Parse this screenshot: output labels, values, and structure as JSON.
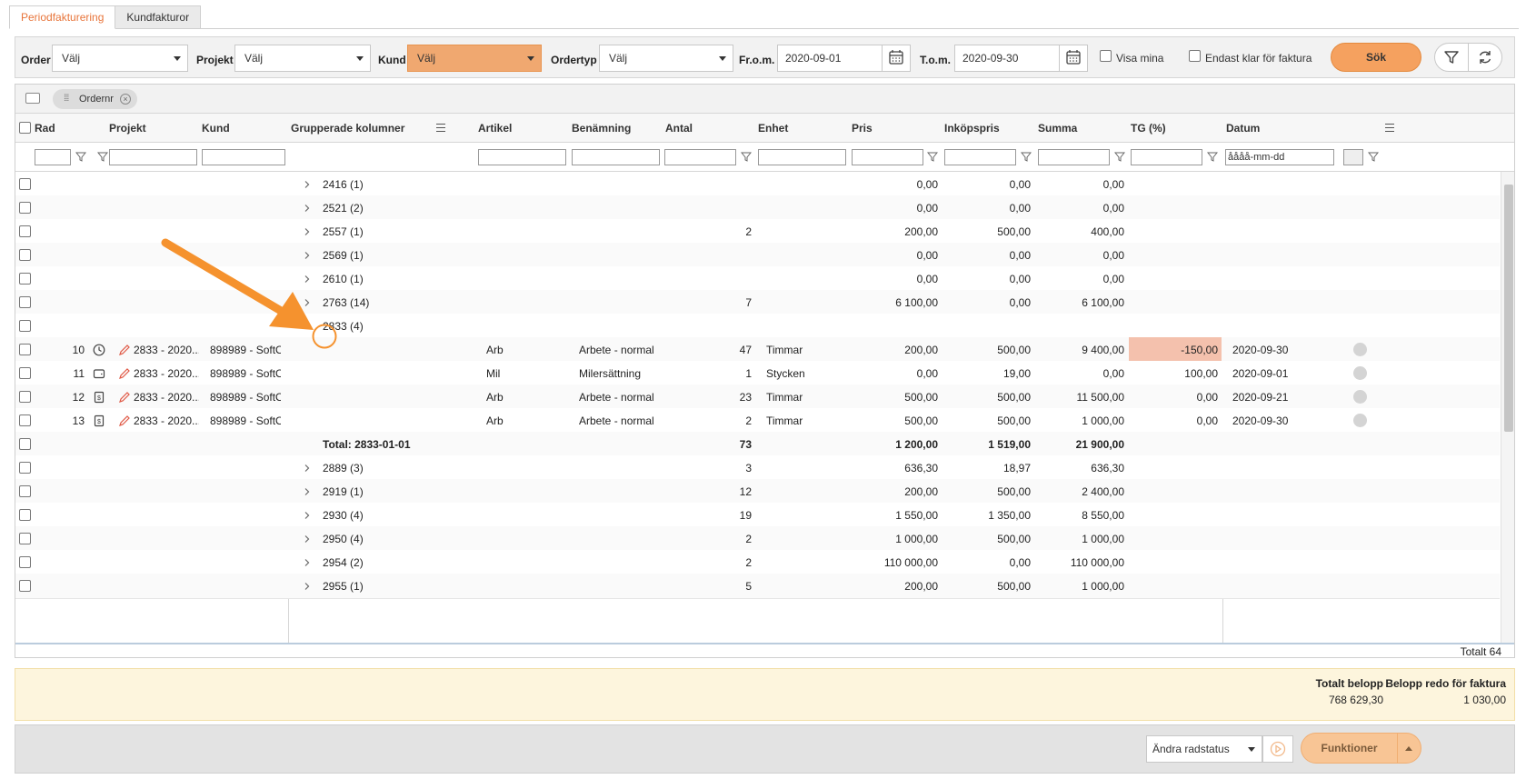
{
  "tabs": [
    {
      "label": "Periodfakturering"
    },
    {
      "label": "Kundfakturor"
    }
  ],
  "toolbar": {
    "order_label": "Order",
    "order_value": "Välj",
    "projekt_label": "Projekt",
    "projekt_value": "Välj",
    "kund_label": "Kund",
    "kund_value": "Välj",
    "ordertyp_label": "Ordertyp",
    "ordertyp_value": "Välj",
    "from_label": "Fr.o.m.",
    "from_value": "2020-09-01",
    "tom_label": "T.o.m.",
    "tom_value": "2020-09-30",
    "visa_mina": "Visa mina",
    "endast_klar": "Endast klar för faktura",
    "search_button": "Sök"
  },
  "group_chip": "Ordernr",
  "columns": {
    "rad": "Rad",
    "projekt": "Projekt",
    "kund": "Kund",
    "grupperade": "Grupperade kolumner",
    "artikel": "Artikel",
    "benamning": "Benämning",
    "antal": "Antal",
    "enhet": "Enhet",
    "pris": "Pris",
    "inkopspris": "Inköpspris",
    "summa": "Summa",
    "tg": "TG (%)",
    "datum": "Datum"
  },
  "date_filter_placeholder": "åååå-mm-dd",
  "group_rows_top": [
    {
      "label": "2416 (1)",
      "antal": "",
      "pris": "0,00",
      "inkop": "0,00",
      "summa": "0,00"
    },
    {
      "label": "2521 (2)",
      "antal": "",
      "pris": "0,00",
      "inkop": "0,00",
      "summa": "0,00"
    },
    {
      "label": "2557 (1)",
      "antal": "2",
      "pris": "200,00",
      "inkop": "500,00",
      "summa": "400,00"
    },
    {
      "label": "2569 (1)",
      "antal": "",
      "pris": "0,00",
      "inkop": "0,00",
      "summa": "0,00"
    },
    {
      "label": "2610 (1)",
      "antal": "",
      "pris": "0,00",
      "inkop": "0,00",
      "summa": "0,00"
    },
    {
      "label": "2763 (14)",
      "antal": "7",
      "pris": "6 100,00",
      "inkop": "0,00",
      "summa": "6 100,00"
    }
  ],
  "expanded_group": {
    "label": "2833 (4)"
  },
  "detail_rows": [
    {
      "rad": "10",
      "icon": "clock-icon",
      "projekt": "2833 - 2020...",
      "kund": "898989 - SoftO...",
      "artikel": "Arb",
      "benamning": "Arbete - normal ...",
      "antal": "47",
      "enhet": "Timmar",
      "pris": "200,00",
      "inkop": "500,00",
      "summa": "9 400,00",
      "tg": "-150,00",
      "datum": "2020-09-30",
      "tg_negative": true
    },
    {
      "rad": "11",
      "icon": "wallet-icon",
      "projekt": "2833 - 2020...",
      "kund": "898989 - SoftO...",
      "artikel": "Mil",
      "benamning": "Milersättning",
      "antal": "1",
      "enhet": "Stycken",
      "pris": "0,00",
      "inkop": "19,00",
      "summa": "0,00",
      "tg": "100,00",
      "datum": "2020-09-01",
      "tg_negative": false
    },
    {
      "rad": "12",
      "icon": "invoice-icon",
      "projekt": "2833 - 2020...",
      "kund": "898989 - SoftO...",
      "artikel": "Arb",
      "benamning": "Arbete - normal ...",
      "antal": "23",
      "enhet": "Timmar",
      "pris": "500,00",
      "inkop": "500,00",
      "summa": "11 500,00",
      "tg": "0,00",
      "datum": "2020-09-21",
      "tg_negative": false
    },
    {
      "rad": "13",
      "icon": "invoice-icon",
      "projekt": "2833 - 2020...",
      "kund": "898989 - SoftO...",
      "artikel": "Arb",
      "benamning": "Arbete - normal ...",
      "antal": "2",
      "enhet": "Timmar",
      "pris": "500,00",
      "inkop": "500,00",
      "summa": "1 000,00",
      "tg": "0,00",
      "datum": "2020-09-30",
      "tg_negative": false
    }
  ],
  "total_row": {
    "label": "Total: 2833-01-01",
    "antal": "73",
    "pris": "1 200,00",
    "inkop": "1 519,00",
    "summa": "21 900,00"
  },
  "group_rows_bottom": [
    {
      "label": "2889 (3)",
      "antal": "3",
      "pris": "636,30",
      "inkop": "18,97",
      "summa": "636,30"
    },
    {
      "label": "2919 (1)",
      "antal": "12",
      "pris": "200,00",
      "inkop": "500,00",
      "summa": "2 400,00"
    },
    {
      "label": "2930 (4)",
      "antal": "19",
      "pris": "1 550,00",
      "inkop": "1 350,00",
      "summa": "8 550,00"
    },
    {
      "label": "2950 (4)",
      "antal": "2",
      "pris": "1 000,00",
      "inkop": "500,00",
      "summa": "1 000,00"
    },
    {
      "label": "2954 (2)",
      "antal": "2",
      "pris": "110 000,00",
      "inkop": "0,00",
      "summa": "110 000,00"
    },
    {
      "label": "2955 (1)",
      "antal": "5",
      "pris": "200,00",
      "inkop": "500,00",
      "summa": "1 000,00"
    }
  ],
  "footer_total": "Totalt 64",
  "summary": {
    "total_label": "Totalt belopp",
    "total_value": "768 629,30",
    "ready_label": "Belopp redo för faktura",
    "ready_value": "1 030,00"
  },
  "bottom": {
    "status_select": "Ändra radstatus",
    "functions_button": "Funktioner"
  },
  "colors": {
    "accent": "#f5a15f",
    "highlight_negative": "#f4c1ad",
    "summary_bg": "#fdf5dd",
    "arrow": "#f5922e"
  }
}
